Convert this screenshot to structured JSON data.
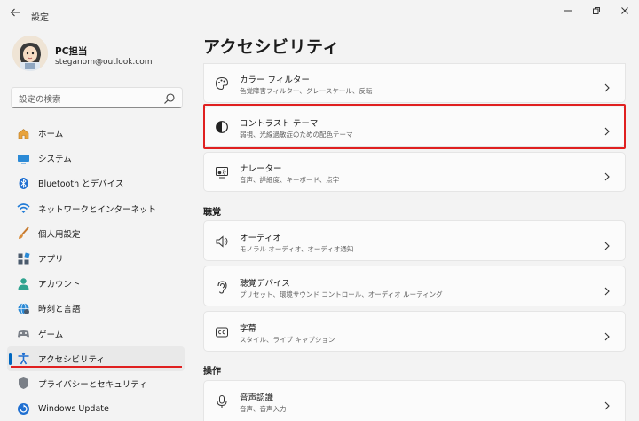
{
  "app": {
    "title": "設定"
  },
  "profile": {
    "name": "PC担当",
    "email": "steganom@outlook.com"
  },
  "search": {
    "placeholder": "設定の検索"
  },
  "sidebar": {
    "items": [
      {
        "label": "ホーム",
        "icon": "home-icon"
      },
      {
        "label": "システム",
        "icon": "system-icon"
      },
      {
        "label": "Bluetooth とデバイス",
        "icon": "bluetooth-icon"
      },
      {
        "label": "ネットワークとインターネット",
        "icon": "network-icon"
      },
      {
        "label": "個人用設定",
        "icon": "brush-icon"
      },
      {
        "label": "アプリ",
        "icon": "apps-icon"
      },
      {
        "label": "アカウント",
        "icon": "account-icon"
      },
      {
        "label": "時刻と言語",
        "icon": "time-language-icon"
      },
      {
        "label": "ゲーム",
        "icon": "gaming-icon"
      },
      {
        "label": "アクセシビリティ",
        "icon": "accessibility-icon",
        "active": true
      },
      {
        "label": "プライバシーとセキュリティ",
        "icon": "shield-icon"
      },
      {
        "label": "Windows Update",
        "icon": "update-icon"
      }
    ]
  },
  "main": {
    "title": "アクセシビリティ",
    "cards_top": [
      {
        "title": "カラー フィルター",
        "subtitle": "色覚障害フィルター、グレースケール、反転",
        "icon": "palette-icon"
      },
      {
        "title": "コントラスト テーマ",
        "subtitle": "弱視、光線過敏症のための配色テーマ",
        "icon": "contrast-icon",
        "highlighted": true
      },
      {
        "title": "ナレーター",
        "subtitle": "音声、詳細度、キーボード、点字",
        "icon": "narrator-icon"
      }
    ],
    "section_hearing": "聴覚",
    "cards_hearing": [
      {
        "title": "オーディオ",
        "subtitle": "モノラル オーディオ、オーディオ通知",
        "icon": "speaker-icon"
      },
      {
        "title": "聴覚デバイス",
        "subtitle": "プリセット、環境サウンド コントロール、オーディオ ルーティング",
        "icon": "ear-icon"
      },
      {
        "title": "字幕",
        "subtitle": "スタイル、ライブ キャプション",
        "icon": "captions-icon"
      }
    ],
    "section_interaction": "操作",
    "cards_interaction": [
      {
        "title": "音声認識",
        "subtitle": "音声、音声入力",
        "icon": "microphone-icon"
      }
    ]
  },
  "colors": {
    "accent": "#0067c0",
    "highlight": "#e02020",
    "background": "#f3f3f3",
    "card": "#fbfbfb"
  }
}
